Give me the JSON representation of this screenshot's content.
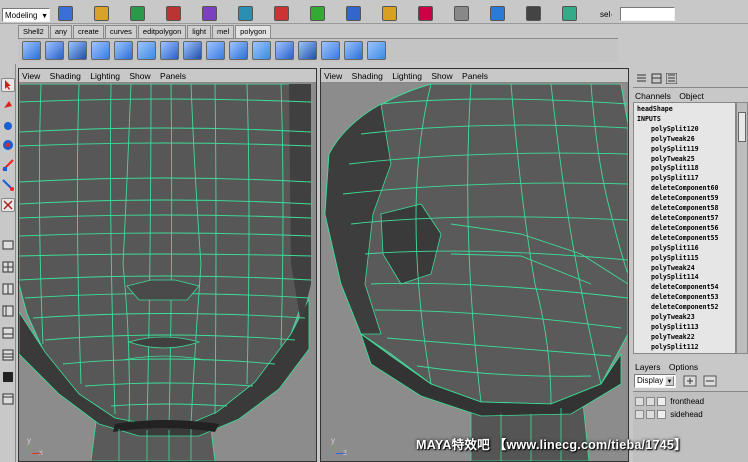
{
  "status_line": {
    "menu_set": "Modeling",
    "selection_label": "sel∙",
    "icons": [
      "new-scene-icon",
      "open-scene-icon",
      "save-scene-icon",
      "select-hierarchy-icon",
      "select-object-icon",
      "select-component-icon",
      "snap-grid-icon",
      "snap-curve-icon",
      "snap-point-icon",
      "render-icon",
      "ipr-render-icon",
      "render-globals-icon",
      "show-ui-icon",
      "attribute-editor-icon",
      "channel-box-icon"
    ]
  },
  "shelf": {
    "tabs": [
      "Shell2",
      "any",
      "create",
      "curves",
      "editpolygon",
      "light",
      "mel",
      "polygon"
    ],
    "active_tab": "polygon",
    "icons": [
      "poly-plane-icon",
      "poly-cube-icon",
      "poly-sphere-icon",
      "poly-cylinder-icon",
      "poly-torus-icon",
      "extrude-face-icon",
      "split-polygon-icon",
      "merge-vertex-icon",
      "smooth-icon",
      "append-polygon-icon",
      "cut-faces-icon",
      "bevel-icon",
      "subdiv-icon",
      "mirror-icon",
      "combine-icon",
      "triangulate-icon"
    ]
  },
  "viewports": [
    {
      "id": "front",
      "menus": [
        "View",
        "Shading",
        "Lighting",
        "Show",
        "Panels"
      ]
    },
    {
      "id": "side",
      "menus": [
        "View",
        "Shading",
        "Lighting",
        "Show",
        "Panels"
      ]
    }
  ],
  "axis": {
    "y": "y",
    "x": "x",
    "z": "z"
  },
  "channel_box": {
    "tabs": [
      "Channels",
      "Object"
    ],
    "shape_name": "headShape",
    "inputs_label": "INPUTS",
    "inputs": [
      "polySplit120",
      "polyTweak26",
      "polySplit119",
      "polyTweak25",
      "polySplit118",
      "polySplit117",
      "deleteComponent60",
      "deleteComponent59",
      "deleteComponent58",
      "deleteComponent57",
      "deleteComponent56",
      "deleteComponent55",
      "polySplit116",
      "polySplit115",
      "polyTweak24",
      "polySplit114",
      "deleteComponent54",
      "deleteComponent53",
      "deleteComponent52",
      "polyTweak23",
      "polySplit113",
      "polyTweak22",
      "polySplit112"
    ]
  },
  "layer_editor": {
    "tabs": [
      "Layers",
      "Options"
    ],
    "display_mode": "Display",
    "layers": [
      "fronthead",
      "sidehead"
    ]
  },
  "watermark": "MAYA特效吧 【www.linecg.com/tieba/1745】",
  "colors": {
    "background": "#c8c8c8",
    "viewport": "#8c8c8c",
    "wireframe": "#3ddc9a",
    "mesh_dark": "#3a3a3a",
    "mesh_mid": "#555555"
  }
}
